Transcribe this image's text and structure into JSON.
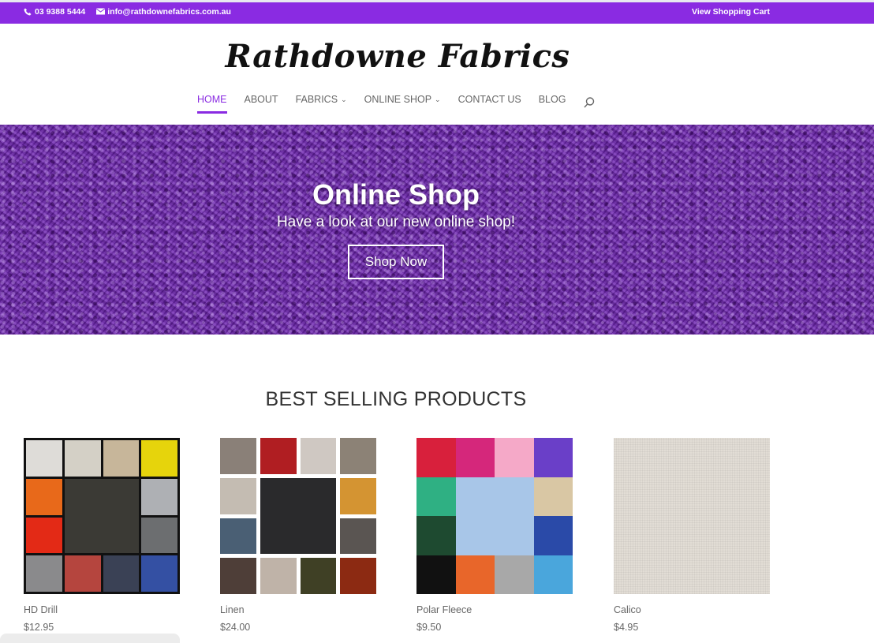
{
  "topbar": {
    "phone": "03 9388 5444",
    "email": "info@rathdownefabrics.com.au",
    "cart": "View Shopping Cart",
    "bg_color": "#8a2be2"
  },
  "header": {
    "logo": "Rathdowne Fabrics",
    "nav": [
      {
        "label": "HOME",
        "active": true,
        "dropdown": false
      },
      {
        "label": "ABOUT",
        "active": false,
        "dropdown": false
      },
      {
        "label": "FABRICS",
        "active": false,
        "dropdown": true
      },
      {
        "label": "ONLINE SHOP",
        "active": false,
        "dropdown": true
      },
      {
        "label": "CONTACT US",
        "active": false,
        "dropdown": false
      },
      {
        "label": "BLOG",
        "active": false,
        "dropdown": false
      }
    ],
    "search_icon": "search-icon"
  },
  "hero": {
    "title": "Online Shop",
    "subtitle": "Have a look at our new online shop!",
    "button": "Shop Now"
  },
  "best_sellers": {
    "title": "BEST SELLING PRODUCTS",
    "products": [
      {
        "name": "HD Drill",
        "price": "$12.95"
      },
      {
        "name": "Linen",
        "price": "$24.00"
      },
      {
        "name": "Polar Fleece",
        "price": "$9.50"
      },
      {
        "name": "Calico",
        "price": "$4.95"
      }
    ]
  },
  "swatches": {
    "hd_drill": [
      "#dedcd8",
      "#d4d0c6",
      "#c7b69a",
      "#e6d40c",
      "#e8691a",
      "#aeb0b4",
      "#e32a16",
      "#6c6e70",
      "#8a8a8c",
      "#b5453e",
      "#3a4155",
      "#3450a3"
    ],
    "hd_drill_center": "#3b3a35",
    "linen": [
      "#8a8078",
      "#b01e22",
      "#cfc8c2",
      "#8c8276",
      "#c4bcb2",
      "#d49432",
      "#4a5f74",
      "#5a5552",
      "#4e3e38",
      "#bfb3a8",
      "#3f4025",
      "#8c2a12"
    ],
    "linen_center": "#2a2a2c",
    "fleece": [
      "#d8203c",
      "#d5277b",
      "#f5a9c8",
      "#6a3fc8",
      "#2fb083",
      "#d9c7a4",
      "#1e4a30",
      "#2a4aa8",
      "#111111",
      "#e8662a",
      "#a8a8a8",
      "#4aa6dc"
    ],
    "fleece_center": "#a8c6e8"
  }
}
